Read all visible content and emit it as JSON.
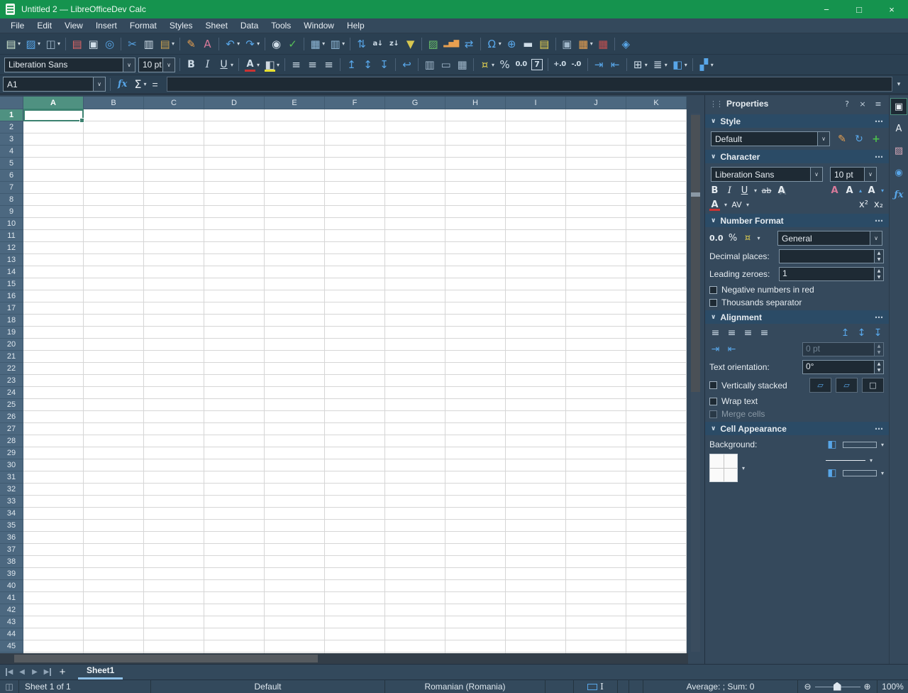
{
  "window": {
    "title": "Untitled 2 — LibreOfficeDev Calc",
    "controls": {
      "minimize": "−",
      "restore": "□",
      "close": "×"
    }
  },
  "menubar": [
    "File",
    "Edit",
    "View",
    "Insert",
    "Format",
    "Styles",
    "Sheet",
    "Data",
    "Tools",
    "Window",
    "Help"
  ],
  "toolbar_standard": [
    {
      "t": "btn",
      "n": "new-document",
      "g": "▤",
      "c": "#cfe6cf",
      "dd": 1
    },
    {
      "t": "btn",
      "n": "open-file",
      "g": "▨",
      "c": "#58a6e8",
      "dd": 1
    },
    {
      "t": "btn",
      "n": "save",
      "g": "◫",
      "c": "#9fb6c9",
      "dd": 1
    },
    {
      "t": "sep"
    },
    {
      "t": "btn",
      "n": "export-pdf",
      "g": "▤",
      "c": "#e06666"
    },
    {
      "t": "btn",
      "n": "print",
      "g": "▣",
      "c": "#cfdde8"
    },
    {
      "t": "btn",
      "n": "print-preview",
      "g": "◎",
      "c": "#58a6e8"
    },
    {
      "t": "sep"
    },
    {
      "t": "btn",
      "n": "cut",
      "g": "✂",
      "c": "#58a6e8"
    },
    {
      "t": "btn",
      "n": "copy",
      "g": "▥",
      "c": "#cfdde8"
    },
    {
      "t": "btn",
      "n": "paste",
      "g": "▤",
      "c": "#c8a050",
      "dd": 1
    },
    {
      "t": "sep"
    },
    {
      "t": "btn",
      "n": "clone-formatting",
      "g": "✎",
      "c": "#e8a050"
    },
    {
      "t": "btn",
      "n": "clear-formatting",
      "g": "A",
      "c": "#d87a9a"
    },
    {
      "t": "sep"
    },
    {
      "t": "btn",
      "n": "undo",
      "g": "↶",
      "c": "#58a6e8",
      "dd": 1
    },
    {
      "t": "btn",
      "n": "redo",
      "g": "↷",
      "c": "#58a6e8",
      "dd": 1
    },
    {
      "t": "sep"
    },
    {
      "t": "btn",
      "n": "find-and-replace",
      "g": "◉",
      "c": "#cfdde8"
    },
    {
      "t": "btn",
      "n": "spelling",
      "g": "✓",
      "c": "#58c058"
    },
    {
      "t": "sep"
    },
    {
      "t": "btn",
      "n": "insert-rows",
      "g": "▦",
      "c": "#8fb8d8",
      "dd": 1
    },
    {
      "t": "btn",
      "n": "insert-columns",
      "g": "▥",
      "c": "#8fb8d8",
      "dd": 1
    },
    {
      "t": "sep"
    },
    {
      "t": "btn",
      "n": "sort",
      "g": "⇅",
      "c": "#58a6e8"
    },
    {
      "t": "btn",
      "n": "sort-ascending",
      "g": "a↓",
      "c": "#cfdde8",
      "small": 1
    },
    {
      "t": "btn",
      "n": "sort-descending",
      "g": "z↓",
      "c": "#cfdde8",
      "small": 1
    },
    {
      "t": "btn",
      "n": "autofilter",
      "g": "▼",
      "c": "#d8c850"
    },
    {
      "t": "sep"
    },
    {
      "t": "btn",
      "n": "insert-image",
      "g": "▨",
      "c": "#6abf6a"
    },
    {
      "t": "btn",
      "n": "insert-chart",
      "g": "▂▅▇",
      "c": "#e8a050",
      "small": 1
    },
    {
      "t": "btn",
      "n": "insert-pivot-table",
      "g": "⇄",
      "c": "#58a6e8"
    },
    {
      "t": "sep"
    },
    {
      "t": "btn",
      "n": "insert-special-character",
      "g": "Ω",
      "c": "#58a6e8",
      "dd": 1
    },
    {
      "t": "btn",
      "n": "insert-hyperlink",
      "g": "⊕",
      "c": "#58a6e8"
    },
    {
      "t": "btn",
      "n": "insert-comment",
      "g": "▬",
      "c": "#cfdde8"
    },
    {
      "t": "btn",
      "n": "headers-and-footers",
      "g": "▤",
      "c": "#e8d050"
    },
    {
      "t": "sep"
    },
    {
      "t": "btn",
      "n": "define-print-area",
      "g": "▣",
      "c": "#9fb6c9"
    },
    {
      "t": "btn",
      "n": "autoformat-styles",
      "g": "▦",
      "c": "#e8a050",
      "dd": 1
    },
    {
      "t": "btn",
      "n": "freeze-rows-and-columns",
      "g": "▦",
      "c": "#c05050"
    },
    {
      "t": "sep"
    },
    {
      "t": "btn",
      "n": "show-draw-functions",
      "g": "◈",
      "c": "#58a6e8"
    }
  ],
  "toolbar_formatting": [
    {
      "t": "combo",
      "n": "font-name",
      "v": "Liberation Sans",
      "w": 185
    },
    {
      "t": "combo",
      "n": "font-size",
      "v": "10 pt",
      "w": 52
    },
    {
      "t": "sep"
    },
    {
      "t": "btn",
      "n": "bold",
      "g": "B",
      "cls": "b"
    },
    {
      "t": "btn",
      "n": "italic",
      "g": "I",
      "cls": "i"
    },
    {
      "t": "btn",
      "n": "underline",
      "g": "U",
      "cls": "u",
      "dd": 1
    },
    {
      "t": "sep"
    },
    {
      "t": "btn",
      "n": "font-color",
      "g": "A",
      "cls": "fc",
      "dd": 1
    },
    {
      "t": "btn",
      "n": "highlighting-color",
      "g": "◧",
      "c": "#cfd8e0",
      "cls": "hc",
      "dd": 1
    },
    {
      "t": "sep"
    },
    {
      "t": "btn",
      "n": "align-left",
      "g": "≡",
      "c": "#cfdde8"
    },
    {
      "t": "btn",
      "n": "align-center",
      "g": "≡",
      "c": "#cfdde8"
    },
    {
      "t": "btn",
      "n": "align-right",
      "g": "≡",
      "c": "#cfdde8"
    },
    {
      "t": "sep"
    },
    {
      "t": "btn",
      "n": "align-top",
      "g": "↥",
      "c": "#58a6e8"
    },
    {
      "t": "btn",
      "n": "center-vertically",
      "g": "↕",
      "c": "#58a6e8"
    },
    {
      "t": "btn",
      "n": "align-bottom",
      "g": "↧",
      "c": "#58a6e8"
    },
    {
      "t": "sep"
    },
    {
      "t": "btn",
      "n": "wrap-text",
      "g": "↩",
      "c": "#58a6e8"
    },
    {
      "t": "sep"
    },
    {
      "t": "btn",
      "n": "merge-and-center-cells",
      "g": "▥",
      "c": "#9fb6c9"
    },
    {
      "t": "btn",
      "n": "merge-cells",
      "g": "▭",
      "c": "#9fb6c9"
    },
    {
      "t": "btn",
      "n": "unmerge-cells",
      "g": "▦",
      "c": "#9fb6c9"
    },
    {
      "t": "sep"
    },
    {
      "t": "btn",
      "n": "format-as-currency",
      "g": "¤",
      "c": "#d8c850",
      "dd": 1
    },
    {
      "t": "btn",
      "n": "format-as-percent",
      "g": "%",
      "c": "#cfdde8"
    },
    {
      "t": "btn",
      "n": "format-as-number",
      "g": "0.0",
      "c": "#cfdde8",
      "small": 1
    },
    {
      "t": "btn",
      "n": "format-as-date",
      "g": "7",
      "c": "#cfdde8",
      "cls": "boxed"
    },
    {
      "t": "sep"
    },
    {
      "t": "btn",
      "n": "add-decimal-place",
      "g": "+.0",
      "c": "#cfdde8",
      "small": 1
    },
    {
      "t": "btn",
      "n": "delete-decimal-place",
      "g": "-.0",
      "c": "#cfdde8",
      "small": 1
    },
    {
      "t": "sep"
    },
    {
      "t": "btn",
      "n": "increase-indent",
      "g": "⇥",
      "c": "#58a6e8"
    },
    {
      "t": "btn",
      "n": "decrease-indent",
      "g": "⇤",
      "c": "#58a6e8"
    },
    {
      "t": "sep"
    },
    {
      "t": "btn",
      "n": "borders",
      "g": "⊞",
      "c": "#cfdde8",
      "dd": 1
    },
    {
      "t": "btn",
      "n": "border-style",
      "g": "≣",
      "c": "#cfdde8",
      "dd": 1
    },
    {
      "t": "btn",
      "n": "border-color",
      "g": "◧",
      "c": "#58a6e8",
      "dd": 1
    },
    {
      "t": "sep"
    },
    {
      "t": "btn",
      "n": "conditional-formatting",
      "g": "▞",
      "c": "#58a6e8",
      "dd": 1
    }
  ],
  "formula_bar": {
    "cell_reference": "A1",
    "formula": "",
    "function_wizard_label": "fx",
    "sum_label": "Σ",
    "equals_label": "="
  },
  "grid": {
    "columns": [
      "A",
      "B",
      "C",
      "D",
      "E",
      "F",
      "G",
      "H",
      "I",
      "J",
      "K"
    ],
    "row_count": 46,
    "selected_column": "A",
    "selected_row": 1
  },
  "sheet_tabs": {
    "add_label": "+",
    "tabs": [
      {
        "label": "Sheet1",
        "active": true
      }
    ]
  },
  "status_bar": {
    "sheet_info": "Sheet 1 of 1",
    "page_style": "Default",
    "language": "Romanian (Romania)",
    "stats": "Average: ; Sum: 0",
    "zoom_level": "100%"
  },
  "sidebar": {
    "title": "Properties",
    "header": {
      "help": "?",
      "close": "×",
      "menu": "≡"
    },
    "tabs": [
      {
        "name": "properties",
        "glyph": "▣",
        "color": "#e6ecf1",
        "active": true
      },
      {
        "name": "styles",
        "glyph": "A",
        "color": "#e6ecf1"
      },
      {
        "name": "gallery",
        "glyph": "▨",
        "color": "#d8a8b8"
      },
      {
        "name": "navigator",
        "glyph": "◉",
        "color": "#58a6e8"
      },
      {
        "name": "functions",
        "glyph": "ƒx",
        "color": "#58a6e8"
      }
    ],
    "style": {
      "label": "Style",
      "value": "Default"
    },
    "character": {
      "label": "Character",
      "font_name": "Liberation Sans",
      "font_size": "10 pt",
      "bold": "B",
      "italic": "I",
      "underline": "U",
      "strikethrough": "ab",
      "shadow": "A",
      "clear": "A",
      "grow": "A",
      "shrink": "A",
      "font_color": "A",
      "spacing": "AV",
      "superscript": "x²",
      "subscript": "x₂"
    },
    "number_format": {
      "label": "Number Format",
      "number_icon": "0.0",
      "percent_icon": "%",
      "currency_icon": "¤",
      "category": "General",
      "decimal_places_label": "Decimal places:",
      "decimal_places_value": "",
      "leading_zeroes_label": "Leading zeroes:",
      "leading_zeroes_value": "1",
      "negative_red_label": "Negative numbers in red",
      "thousands_label": "Thousands separator"
    },
    "alignment": {
      "label": "Alignment",
      "indent_value": "0 pt",
      "orientation_label": "Text orientation:",
      "orientation_value": "0°",
      "stacked_label": "Vertically stacked",
      "wrap_label": "Wrap text",
      "merge_label": "Merge cells"
    },
    "cell_appearance": {
      "label": "Cell Appearance",
      "background_label": "Background:"
    }
  },
  "colors": {
    "titlebar_green": "#15934e",
    "chrome_dark_blue": "#2b4052",
    "panel_blue": "#35495c",
    "header_gray_blue": "#4c6880",
    "selection_teal": "#4f9181",
    "accent_blue": "#58a6e8"
  }
}
